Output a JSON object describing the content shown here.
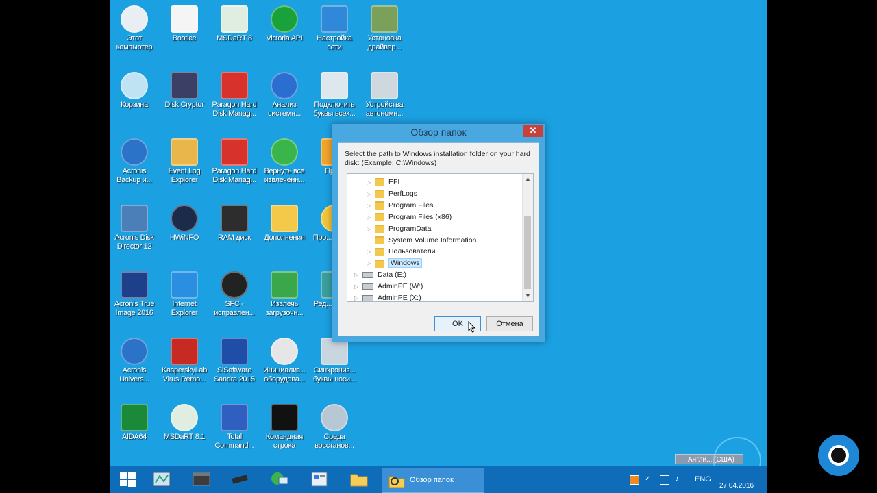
{
  "desktop": {
    "icons": [
      {
        "label": "Этот компьютер",
        "icon": "this-pc-icon"
      },
      {
        "label": "Bootice",
        "icon": "bootice-icon"
      },
      {
        "label": "MSDaRT 8",
        "icon": "msdart-icon"
      },
      {
        "label": "Victoria API",
        "icon": "victoria-icon"
      },
      {
        "label": "Настройка сети",
        "icon": "network-settings-icon"
      },
      {
        "label": "Установка драйвер...",
        "icon": "driver-install-icon"
      },
      {
        "label": "Корзина",
        "icon": "recycle-bin-icon"
      },
      {
        "label": "Disk Cryptor",
        "icon": "diskcryptor-icon"
      },
      {
        "label": "Paragon Hard Disk Manag...",
        "icon": "paragon-icon"
      },
      {
        "label": "Анализ системн...",
        "icon": "system-analysis-icon"
      },
      {
        "label": "Подключить буквы всех...",
        "icon": "mount-drives-icon"
      },
      {
        "label": "Устройства автономн...",
        "icon": "offline-devices-icon"
      },
      {
        "label": "Acronis Backup и...",
        "icon": "acronis-backup-icon"
      },
      {
        "label": "Event Log Explorer",
        "icon": "event-log-icon"
      },
      {
        "label": "Paragon Hard Disk Manag...",
        "icon": "paragon-icon"
      },
      {
        "label": "Вернуть все извлечённ...",
        "icon": "restore-extracted-icon"
      },
      {
        "label": "Про...",
        "icon": "partial-icon"
      },
      {
        "label": "Acronis Disk Director 12",
        "icon": "acronis-dd-icon"
      },
      {
        "label": "HWiNFO",
        "icon": "hwinfo-icon"
      },
      {
        "label": "RAM диск",
        "icon": "ram-disk-icon"
      },
      {
        "label": "Дополнения",
        "icon": "folder-icon"
      },
      {
        "label": "Про... журн...",
        "icon": "partial-icon"
      },
      {
        "label": "Acronis True Image 2016",
        "icon": "acronis-ti-icon"
      },
      {
        "label": "Internet Explorer",
        "icon": "ie-icon"
      },
      {
        "label": "SFC - исправлен...",
        "icon": "sfc-icon"
      },
      {
        "label": "Извлечь загрузочн...",
        "icon": "eject-boot-icon"
      },
      {
        "label": "Ред... реес...",
        "icon": "partial-icon"
      },
      {
        "label": "Acronis Univers...",
        "icon": "acronis-universal-icon"
      },
      {
        "label": "KasperskyLab Virus Remo...",
        "icon": "kaspersky-icon"
      },
      {
        "label": "SiSoftware Sandra 2015",
        "icon": "sandra-icon"
      },
      {
        "label": "Инициализ... оборудова...",
        "icon": "hw-init-icon"
      },
      {
        "label": "Синхрониз... буквы носи...",
        "icon": "sync-letters-icon"
      },
      {
        "label": "AIDA64",
        "icon": "aida64-icon"
      },
      {
        "label": "MSDaRT 8.1",
        "icon": "msdart-icon"
      },
      {
        "label": "Total Command...",
        "icon": "total-commander-icon"
      },
      {
        "label": "Командная строка",
        "icon": "cmd-icon"
      },
      {
        "label": "Среда восстанов...",
        "icon": "recovery-env-icon"
      }
    ]
  },
  "dialog": {
    "title": "Обзор папок",
    "close_glyph": "✕",
    "description": "Select the path to Windows installation folder on your hard disk: (Example: C:\\Windows)",
    "tree": [
      {
        "name": "EFI",
        "type": "folder",
        "expand": "▷"
      },
      {
        "name": "PerfLogs",
        "type": "folder",
        "expand": "▷"
      },
      {
        "name": "Program Files",
        "type": "folder",
        "expand": "▷"
      },
      {
        "name": "Program Files (x86)",
        "type": "folder",
        "expand": "▷"
      },
      {
        "name": "ProgramData",
        "type": "folder",
        "expand": "▷"
      },
      {
        "name": "System Volume Information",
        "type": "folder",
        "expand": ""
      },
      {
        "name": "Пользователи",
        "type": "folder",
        "expand": "▷"
      },
      {
        "name": "Windows",
        "type": "folder",
        "expand": "▷",
        "selected": true
      },
      {
        "name": "Data (E:)",
        "type": "drive",
        "expand": "▷"
      },
      {
        "name": "AdminPE (W:)",
        "type": "drive",
        "expand": "▷"
      },
      {
        "name": "AdminPE (X:)",
        "type": "drive",
        "expand": "▷"
      }
    ],
    "scroll_up": "▲",
    "scroll_down": "▼",
    "ok_label": "OK",
    "cancel_label": "Отмена"
  },
  "taskbar": {
    "active_task_label": "Обзор папок",
    "lang": "ENG",
    "date": "27.04.2016",
    "lang_pill": "Англи... (США)"
  },
  "colors": {
    "desktop": "#1ba1e2",
    "taskbar": "#0f6cb8",
    "dialog_frame": "#4aa8e0",
    "close_button": "#c7403a"
  }
}
